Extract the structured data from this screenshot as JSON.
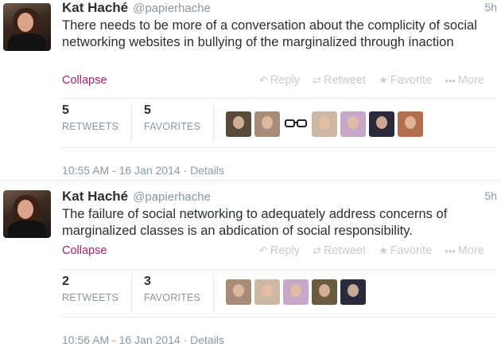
{
  "tweets": [
    {
      "name": "Kat Haché",
      "handle": "@papierhache",
      "time": "5h",
      "text": "There needs to be more of a conversation about the complicity of social networking websites in bullying of the marginalized through inaction",
      "collapse": "Collapse",
      "actions": {
        "reply": "Reply",
        "retweet": "Retweet",
        "favorite": "Favorite",
        "more": "More"
      },
      "stats": {
        "retweets_count": "5",
        "retweets_label": "RETWEETS",
        "favorites_count": "5",
        "favorites_label": "FAVORITES"
      },
      "timestamp": "10:55 AM - 16 Jan 2014",
      "details": "Details",
      "favoriter_avatars": [
        "#5a4a3a",
        "#a88c7a",
        "glasses",
        "#cdb8a4",
        "#c8a8c8",
        "#2a2a3a",
        "#b07050"
      ]
    },
    {
      "name": "Kat Haché",
      "handle": "@papierhache",
      "time": "5h",
      "text": "The failure of social networking to adequately address concerns of marginalized classes is an abdication of social responsibility.",
      "collapse": "Collapse",
      "actions": {
        "reply": "Reply",
        "retweet": "Retweet",
        "favorite": "Favorite",
        "more": "More"
      },
      "stats": {
        "retweets_count": "2",
        "retweets_label": "RETWEETS",
        "favorites_count": "3",
        "favorites_label": "FAVORITES"
      },
      "timestamp": "10:56 AM - 16 Jan 2014",
      "details": "Details",
      "favoriter_avatars": [
        "#a88c7a",
        "#cdb8a4",
        "#c8a8c8",
        "#6a5a40",
        "#2a2a3a"
      ]
    }
  ],
  "icons": {
    "reply": "reply-arrow-icon",
    "retweet": "retweet-icon",
    "favorite": "star-icon",
    "more": "ellipsis-icon"
  },
  "colors": {
    "collapse_link": "#a5236b",
    "muted": "#8899a6",
    "action_disabled": "#c8ccd0"
  }
}
